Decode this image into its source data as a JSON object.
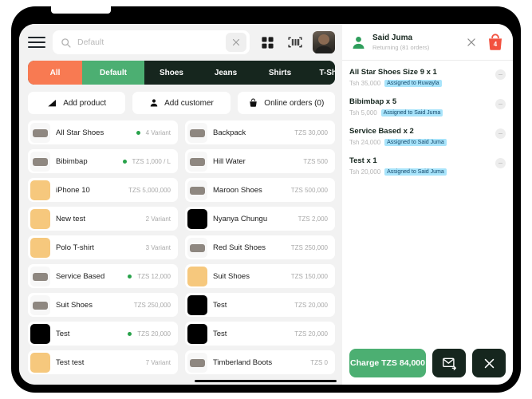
{
  "topbar": {
    "menu_icon": "hamburger-icon",
    "search_icon": "search-icon",
    "search_value": "",
    "search_placeholder": "Default",
    "clear_icon": "close-icon",
    "grid_icon": "grid-view-icon",
    "barcode_icon": "barcode-scan-icon",
    "avatar_icon": "user-avatar"
  },
  "categories": [
    {
      "label": "All",
      "style": "tab-all"
    },
    {
      "label": "Default",
      "style": "tab-default"
    },
    {
      "label": "Shoes",
      "style": "tab-plain"
    },
    {
      "label": "Jeans",
      "style": "tab-plain"
    },
    {
      "label": "Shirts",
      "style": "tab-plain"
    },
    {
      "label": "T-Shirts",
      "style": "tab-plain"
    }
  ],
  "actions": [
    {
      "label": "Add product",
      "icon": "add-product-icon"
    },
    {
      "label": "Add customer",
      "icon": "person-icon"
    },
    {
      "label": "Online orders (0)",
      "icon": "basket-icon"
    }
  ],
  "products_left": [
    {
      "name": "All Star Shoes",
      "meta": "4 Variant",
      "thumb": "white",
      "active": true
    },
    {
      "name": "Bibimbap",
      "meta": "TZS 1,000 / L",
      "thumb": "white",
      "active": true
    },
    {
      "name": "iPhone 10",
      "meta": "TZS 5,000,000",
      "thumb": "tan",
      "active": false
    },
    {
      "name": "New test",
      "meta": "2 Variant",
      "thumb": "tan",
      "active": false
    },
    {
      "name": "Polo T-shirt",
      "meta": "3 Variant",
      "thumb": "tan",
      "active": false
    },
    {
      "name": "Service Based",
      "meta": "TZS 12,000",
      "thumb": "white",
      "active": true
    },
    {
      "name": "Suit Shoes",
      "meta": "TZS 250,000",
      "thumb": "white",
      "active": false
    },
    {
      "name": "Test",
      "meta": "TZS 20,000",
      "thumb": "black",
      "active": true
    },
    {
      "name": "Test test",
      "meta": "7 Variant",
      "thumb": "tan",
      "active": false
    }
  ],
  "products_right": [
    {
      "name": "Backpack",
      "meta": "TZS 30,000",
      "thumb": "white",
      "active": false
    },
    {
      "name": "Hill Water",
      "meta": "TZS 500",
      "thumb": "white",
      "active": false
    },
    {
      "name": "Maroon Shoes",
      "meta": "TZS 500,000",
      "thumb": "white",
      "active": false
    },
    {
      "name": "Nyanya Chungu",
      "meta": "TZS 2,000",
      "thumb": "black",
      "active": false
    },
    {
      "name": "Red Suit Shoes",
      "meta": "TZS 250,000",
      "thumb": "white",
      "active": false
    },
    {
      "name": "Suit Shoes",
      "meta": "TZS 150,000",
      "thumb": "tan",
      "active": false
    },
    {
      "name": "Test",
      "meta": "TZS 20,000",
      "thumb": "black",
      "active": false
    },
    {
      "name": "Test",
      "meta": "TZS 20,000",
      "thumb": "black",
      "active": false
    },
    {
      "name": "Timberland Boots",
      "meta": "TZS 0",
      "thumb": "white",
      "active": false
    }
  ],
  "cart": {
    "customer_name": "Said Juma",
    "customer_sub": "Returning (81 orders)",
    "customer_icon": "person-icon",
    "close_icon": "close-icon",
    "bag_icon": "shopping-bag-icon",
    "bag_count": "4",
    "items": [
      {
        "title": "All Star Shoes Size 9 x 1",
        "price": "Tsh 35,000",
        "tag": "Assigned to Ruwayla"
      },
      {
        "title": "Bibimbap x 5",
        "price": "Tsh 5,000",
        "tag": "Assigned to Said Juma"
      },
      {
        "title": "Service Based x 2",
        "price": "Tsh 24,000",
        "tag": "Assigned to Said Juma"
      },
      {
        "title": "Test x 1",
        "price": "Tsh 20,000",
        "tag": "Assigned to Said Juma"
      }
    ],
    "charge_label": "Charge TZS 84,000",
    "email_icon": "send-email-icon",
    "cancel_icon": "close-icon"
  },
  "colors": {
    "accent_orange": "#f87a52",
    "accent_green": "#4caf72",
    "dark_green": "#16261e",
    "tag_blue": "#a8e4fb",
    "bag_red": "#f2513f"
  }
}
